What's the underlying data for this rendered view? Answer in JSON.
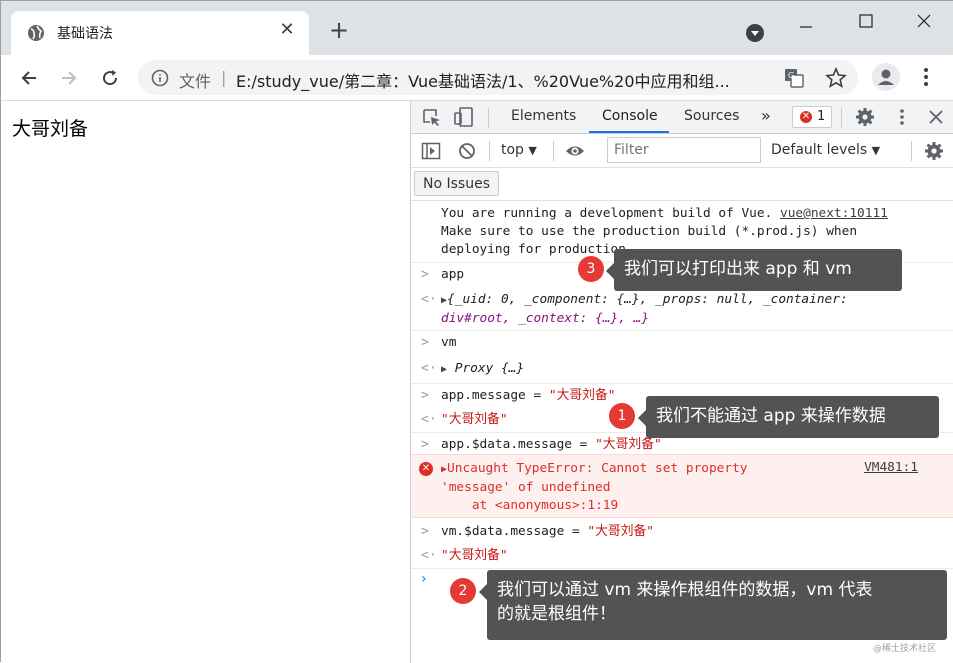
{
  "browser": {
    "tab_title": "基础语法",
    "omnibox": {
      "scheme_label": "文件",
      "separator": "|",
      "url": "E:/study_vue/第二章：Vue基础语法/1、%20Vue%20中应用和组..."
    }
  },
  "page": {
    "text": "大哥刘备"
  },
  "devtools": {
    "tabs": [
      "Elements",
      "Console",
      "Sources"
    ],
    "more_tabs": "»",
    "active_tab": "Console",
    "error_count": "1",
    "context": "top",
    "filter_placeholder": "Filter",
    "levels": "Default levels",
    "issues_button": "No Issues"
  },
  "console": {
    "vue_notice_line1": "You are running a development build of Vue.",
    "vue_notice_link": "vue@next:10111",
    "vue_notice_line2": "Make sure to use the production build (*.prod.js) when",
    "vue_notice_line3": "deploying for production.",
    "in1": "app",
    "out1_line1": "{_uid: 0, _component: {…}, _props: null, _container:",
    "out1_line2": "div#root, _context: {…}, …}",
    "in2": "vm",
    "out2": "Proxy {…}",
    "in3_code": "app.message = ",
    "in3_str": "\"大哥刘备\"",
    "out3": "\"大哥刘备\"",
    "in4_code": "app.$data.message = ",
    "in4_str": "\"大哥刘备\"",
    "error_line1": "Uncaught TypeError: Cannot set property",
    "error_line2": "'message' of undefined",
    "error_line3": "    at <anonymous>:1:19",
    "error_source": "VM481:1",
    "in5_code": "vm.$data.message = ",
    "in5_str": "\"大哥刘备\"",
    "out5": "\"大哥刘备\"",
    "prompt": "›"
  },
  "annotations": [
    {
      "num": "3",
      "text": "我们可以打印出来 app 和 vm"
    },
    {
      "num": "1",
      "text": "我们不能通过 app 来操作数据"
    },
    {
      "num": "2",
      "text_line1": "我们可以通过 vm 来操作根组件的数据，vm 代表",
      "text_line2": "的就是根组件！"
    }
  ],
  "watermark": "@稀土技术社区"
}
